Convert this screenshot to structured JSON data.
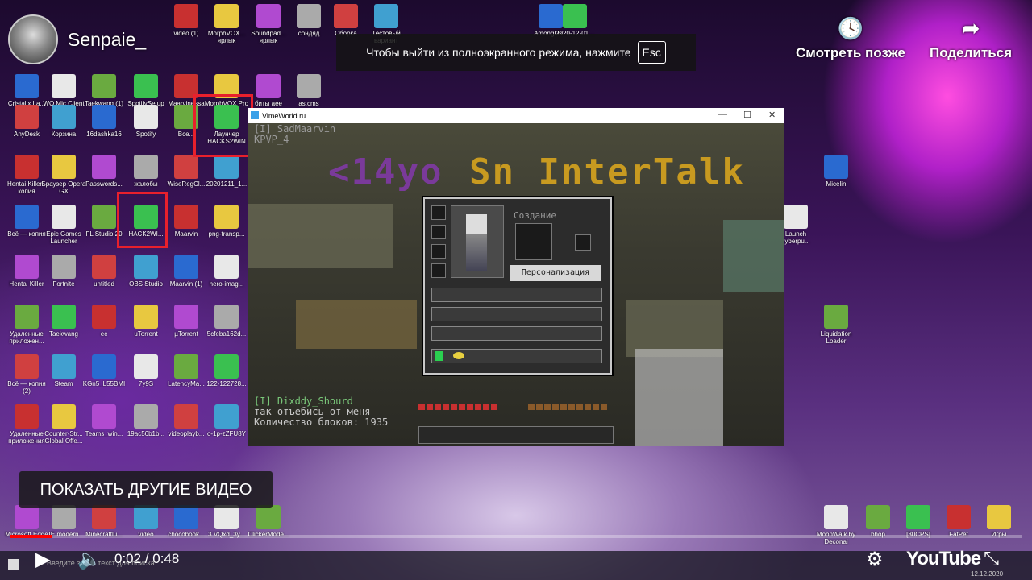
{
  "channel": {
    "name": "Senpaie_"
  },
  "fullscreen_notice": {
    "text": "Чтобы выйти из полноэкранного режима, нажмите",
    "key": "Esc"
  },
  "actions": {
    "watch_later": "Смотреть позже",
    "share": "Поделиться"
  },
  "desktop_icons": [
    "Cristalix La...",
    "WO Mic Client",
    "Taekwang (1)",
    "SpotifySetup",
    "Maarvinessa",
    "MorphVOX Pro",
    "биты аее",
    "as.cms",
    "AnyDesk",
    "Корзина",
    "16dashka16",
    "Spotify",
    "Все...",
    "Лаунчер HACKS2WIN",
    "Hentai Killer - копия",
    "Браузер Opera GX",
    "Passwords...",
    "жалобы",
    "WiseRegCl...",
    "20201211_1...",
    "Всё — копия",
    "Epic Games Launcher",
    "FL Studio 20",
    "HACK2WI...",
    "Maarvin",
    "png-transp...",
    "Hentai Killer",
    "Fortnite",
    "untitled",
    "OBS Studio",
    "Maarvin (1)",
    "hero-imag...",
    "Удаленные приложен...",
    "Taekwang",
    "ec",
    "uTorrent",
    "µTorrent",
    "5cfeba162d...",
    "Всё — копия (2)",
    "Steam",
    "KGn5_L55BMI",
    "7y9S",
    "LatencyMa...",
    "122-122728...",
    "Удаленные приложения",
    "Counter-Str... Global Offe...",
    "Teams_win...",
    "19ac56b1b...",
    "videoplayb...",
    "o-1p-zZFU8Y",
    "Micelin",
    "Launch cyberpu...",
    "Liquidation Loader",
    "2020-12-01...",
    "video (1)",
    "MorphVOX... ярлык",
    "Soundpad... ярлык",
    "сондяд",
    "Сборка",
    "Тестовый вариант",
    "AmongUs...",
    "MoonWalk by Deconai",
    "bhop",
    "[30CPS]",
    "FatPet",
    "Игры",
    "Microsoft Edge",
    "IE.modern",
    "Minecraftlu...",
    "video",
    "chocobook...",
    "3.VQxd_3y...",
    "ClickerMode..."
  ],
  "window": {
    "title": "VimeWorld.ru"
  },
  "game": {
    "top_lines": [
      "[I] SadMaarvin",
      "KPVP_4"
    ],
    "big_left": "<14yo",
    "big_right": "Sn InterTalk",
    "inventory": {
      "create_label": "Создание",
      "personalize_button": "Персонализация"
    },
    "chat": [
      "[I] Dixddy_Shourd",
      "так отъебись от меня",
      "Количество блоков: 1935"
    ]
  },
  "overlay": {
    "more_videos": "ПОКАЗАТЬ ДРУГИЕ ВИДЕО"
  },
  "player": {
    "current_time": "0:02",
    "duration": "0:48",
    "time_text": "0:02 / 0:48",
    "progress_fraction": 0.0417,
    "logo": "YouTube"
  },
  "taskbar": {
    "search_placeholder": "Введите здесь текст для поиска",
    "clock_time": "22:...",
    "clock_date": "12.12.2020"
  }
}
